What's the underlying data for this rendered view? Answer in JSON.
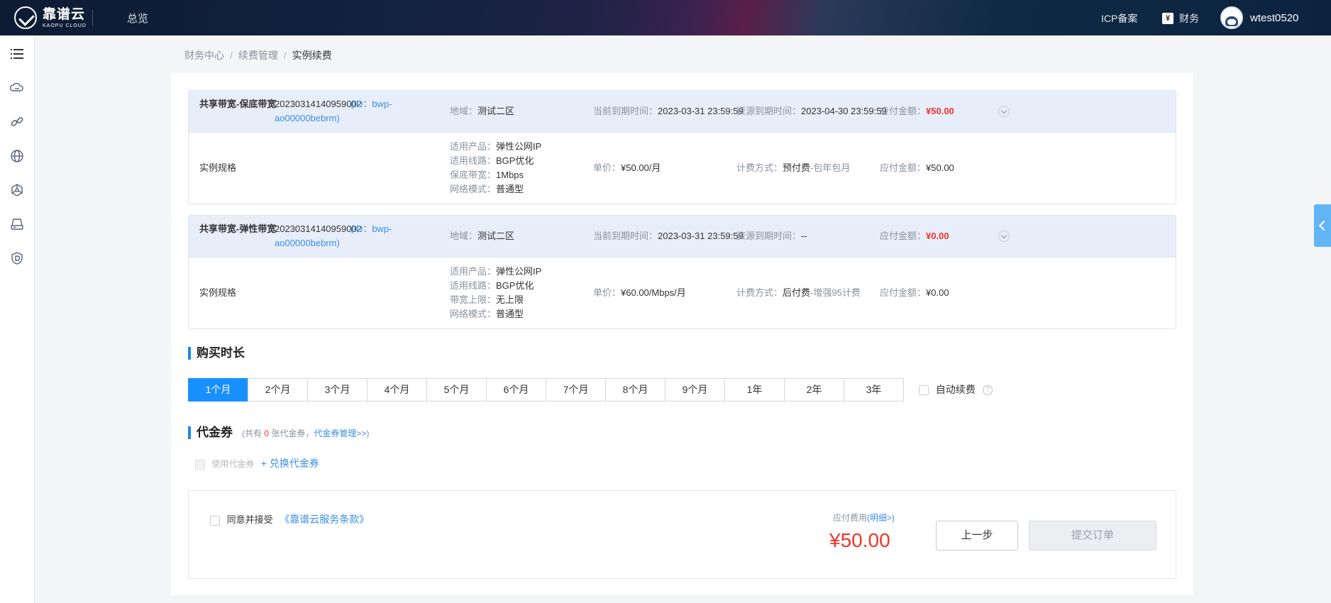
{
  "header": {
    "logo_cn": "靠谱云",
    "logo_en": "KAOPU CLOUD",
    "nav_overview": "总览",
    "icp": "ICP备案",
    "finance": "财务",
    "finance_icon": "yen-icon",
    "username": "wtest0520"
  },
  "sidebar": {
    "items": [
      {
        "icon": "list-icon"
      },
      {
        "icon": "cloud-server-icon"
      },
      {
        "icon": "link-icon"
      },
      {
        "icon": "globe-icon"
      },
      {
        "icon": "network-icon"
      },
      {
        "icon": "storage-icon"
      },
      {
        "icon": "shield-icon"
      }
    ]
  },
  "breadcrumb": {
    "items": [
      "财务中心",
      "续费管理",
      "实例续费"
    ],
    "separator": "/"
  },
  "instances": [
    {
      "name": "共享带宽-保底带宽",
      "order_no": "20230314140959002",
      "id_text_1": "(ID：bwp-",
      "id_text_2": "ao00000bebrm)",
      "region_label": "地域：",
      "region": "测试二区",
      "cur_expire_label": "当前到期时间：",
      "cur_expire": "2023-03-31 23:59:59",
      "res_expire_label": "资源到期时间：",
      "res_expire": "2023-04-30 23:59:59",
      "amount_label": "应付金额：",
      "amount": "¥50.00",
      "spec_label": "实例规格",
      "specs": [
        {
          "k": "适用产品：",
          "v": "弹性公网IP"
        },
        {
          "k": "适用线路：",
          "v": "BGP优化"
        },
        {
          "k": "保底带宽：",
          "v": "1Mbps"
        },
        {
          "k": "网络模式：",
          "v": "普通型"
        }
      ],
      "price_label": "单价：",
      "price": "¥50.00/月",
      "billing_label": "计费方式：",
      "billing_main": "预付费",
      "billing_sub": "-包年包月",
      "detail_amount_label": "应付金额：",
      "detail_amount": "¥50.00"
    },
    {
      "name": "共享带宽-弹性带宽",
      "order_no": "20230314140959002",
      "id_text_1": "(ID：bwp-",
      "id_text_2": "ao00000bebrm)",
      "region_label": "地域：",
      "region": "测试二区",
      "cur_expire_label": "当前到期时间：",
      "cur_expire": "2023-03-31 23:59:59",
      "res_expire_label": "资源到期时间：",
      "res_expire": "--",
      "amount_label": "应付金额：",
      "amount": "¥0.00",
      "spec_label": "实例规格",
      "specs": [
        {
          "k": "适用产品：",
          "v": "弹性公网IP"
        },
        {
          "k": "适用线路：",
          "v": "BGP优化"
        },
        {
          "k": "带宽上限：",
          "v": "无上限"
        },
        {
          "k": "网络模式：",
          "v": "普通型"
        }
      ],
      "price_label": "单价：",
      "price": "¥60.00/Mbps/月",
      "billing_label": "计费方式：",
      "billing_main": "后付费",
      "billing_sub": "-增强95计费",
      "detail_amount_label": "应付金额：",
      "detail_amount": "¥0.00"
    }
  ],
  "duration": {
    "title": "购买时长",
    "options": [
      "1个月",
      "2个月",
      "3个月",
      "4个月",
      "5个月",
      "6个月",
      "7个月",
      "8个月",
      "9个月",
      "1年",
      "2年",
      "3年"
    ],
    "selected": "1个月",
    "auto_renew": "自动续费"
  },
  "voucher": {
    "title": "代金券",
    "note_prefix": "(共有",
    "count": "0",
    "note_mid": "张代金券，",
    "manage_link": "代金券管理>>",
    "note_suffix": ")",
    "use_label": "使用代金券",
    "redeem_link": "+ 兑换代金券"
  },
  "footer": {
    "agree_label": "同意并接受",
    "terms_link": "《靠谱云服务条款》",
    "fee_label": "应付费用",
    "fee_detail": "(明细>)",
    "total": "¥50.00",
    "prev_button": "上一步",
    "submit_button": "提交订单"
  },
  "colors": {
    "accent": "#1890ff",
    "price_red": "#f0352b",
    "link_blue": "#3a8ee6"
  }
}
